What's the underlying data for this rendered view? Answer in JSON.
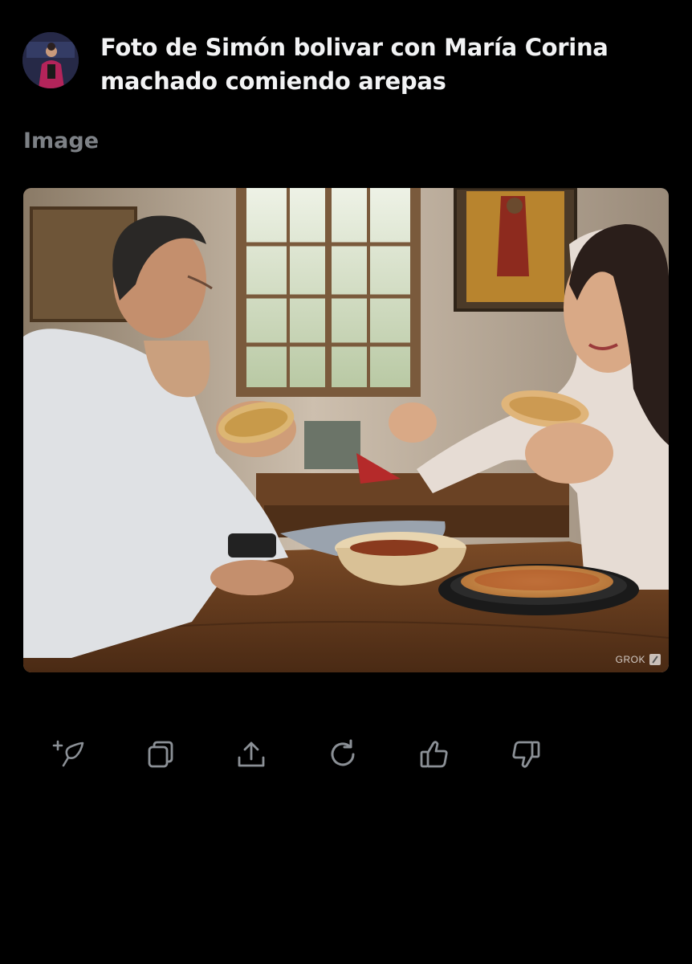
{
  "post": {
    "prompt_text": "Foto de Simón bolivar con María Corina machado comiendo arepas",
    "section_label": "Image",
    "image": {
      "watermark": "GROK"
    }
  },
  "actions": [
    {
      "name": "edit-image",
      "icon": "feather-plus-icon"
    },
    {
      "name": "copy",
      "icon": "copy-icon"
    },
    {
      "name": "share",
      "icon": "share-upload-icon"
    },
    {
      "name": "regenerate",
      "icon": "refresh-icon"
    },
    {
      "name": "like",
      "icon": "thumbs-up-icon"
    },
    {
      "name": "dislike",
      "icon": "thumbs-down-icon"
    }
  ],
  "colors": {
    "background": "#000000",
    "text_primary": "#f2f3f4",
    "text_muted": "#7d8186",
    "icon": "#8b9096"
  }
}
